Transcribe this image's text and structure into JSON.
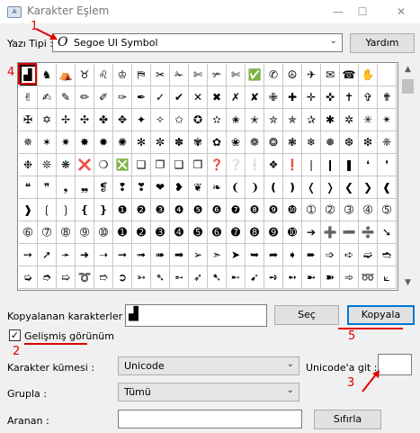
{
  "window": {
    "title": "Karakter Eşlem",
    "app_icon": "A"
  },
  "window_controls": {
    "minimize": "—",
    "maximize": "☐",
    "close": "✕"
  },
  "font": {
    "label": "Yazı Tipi :",
    "value": "Segoe UI Symbol",
    "font_icon": "O"
  },
  "help_button": "Yardım",
  "grid": {
    "rows": [
      [
        "▟",
        "♞",
        "⛺",
        "♉",
        "♌",
        "♔",
        "⛿",
        "✂",
        "✁",
        "✄",
        "✃",
        "✄",
        "✅",
        "✆",
        "☮",
        "✈",
        "✉",
        "☎",
        "✋",
        ""
      ],
      [
        "✌",
        "✍",
        "✎",
        "✏",
        "✐",
        "✑",
        "✒",
        "✓",
        "✔",
        "✕",
        "✖",
        "✗",
        "✘",
        "✙",
        "✚",
        "✛",
        "✜",
        "✝",
        "✞",
        "✟"
      ],
      [
        "✠",
        "✡",
        "✢",
        "✣",
        "✤",
        "✥",
        "✦",
        "✧",
        "✩",
        "✪",
        "✫",
        "✬",
        "✭",
        "✮",
        "✯",
        "✰",
        "✱",
        "✲",
        "✳",
        "✴"
      ],
      [
        "✵",
        "✶",
        "✷",
        "✸",
        "✹",
        "✺",
        "✻",
        "✼",
        "✽",
        "✾",
        "✿",
        "❀",
        "❁",
        "❂",
        "❃",
        "❄",
        "❅",
        "❆",
        "❇",
        "❈"
      ],
      [
        "❉",
        "❊",
        "❋",
        "❌",
        "❍",
        "❎",
        "❏",
        "❐",
        "❑",
        "❒",
        "❓",
        "❔",
        "❕",
        "❖",
        "❗",
        "❘",
        "❙",
        "❚",
        "❛",
        "❜"
      ],
      [
        "❝",
        "❞",
        "❟",
        "❠",
        "❡",
        "❢",
        "❣",
        "❤",
        "❥",
        "❦",
        "❧",
        "❨",
        "❩",
        "❪",
        "❫",
        "❬",
        "❭",
        "❮",
        "❯",
        "❰"
      ],
      [
        "❱",
        "❲",
        "❳",
        "❴",
        "❵",
        "❶",
        "❷",
        "❸",
        "❹",
        "❺",
        "❻",
        "❼",
        "❽",
        "❾",
        "❿",
        "➀",
        "➁",
        "➂",
        "➃",
        "➄"
      ],
      [
        "➅",
        "➆",
        "➇",
        "➈",
        "➉",
        "➊",
        "➋",
        "➌",
        "➍",
        "➎",
        "➏",
        "➐",
        "➑",
        "➒",
        "➓",
        "➔",
        "➕",
        "➖",
        "➗",
        "➘"
      ],
      [
        "➙",
        "➚",
        "➛",
        "➜",
        "➝",
        "➞",
        "➟",
        "➠",
        "➡",
        "➢",
        "➣",
        "➤",
        "➥",
        "➦",
        "➧",
        "➨",
        "➩",
        "➪",
        "➫",
        "➬"
      ],
      [
        "➭",
        "➮",
        "➯",
        "➰",
        "➱",
        "➲",
        "➳",
        "➴",
        "➵",
        "➶",
        "➷",
        "➸",
        "➹",
        "➺",
        "➻",
        "➼",
        "➽",
        "➾",
        "➿",
        "⟀"
      ]
    ],
    "selected_row": 0,
    "selected_col": 0
  },
  "copy_chars": {
    "label": "Kopyalanan karakterler :",
    "value": "▟"
  },
  "select_button": "Seç",
  "copy_button": "Kopyala",
  "advanced": {
    "label": "Gelişmiş görünüm",
    "checked": "✓"
  },
  "charset": {
    "label": "Karakter kümesi :",
    "value": "Unicode"
  },
  "goto_unicode": {
    "label": "Unicode'a git :",
    "value": ""
  },
  "groupby": {
    "label": "Grupla :",
    "value": "Tümü"
  },
  "search": {
    "label": "Aranan :",
    "value": ""
  },
  "reset_button": "Sıfırla",
  "scrollbar": {
    "up": "▲",
    "down": "▼"
  },
  "annotations": {
    "n1": "1",
    "n2": "2",
    "n3": "3",
    "n4": "4",
    "n5": "5"
  },
  "chevron": "⌄"
}
